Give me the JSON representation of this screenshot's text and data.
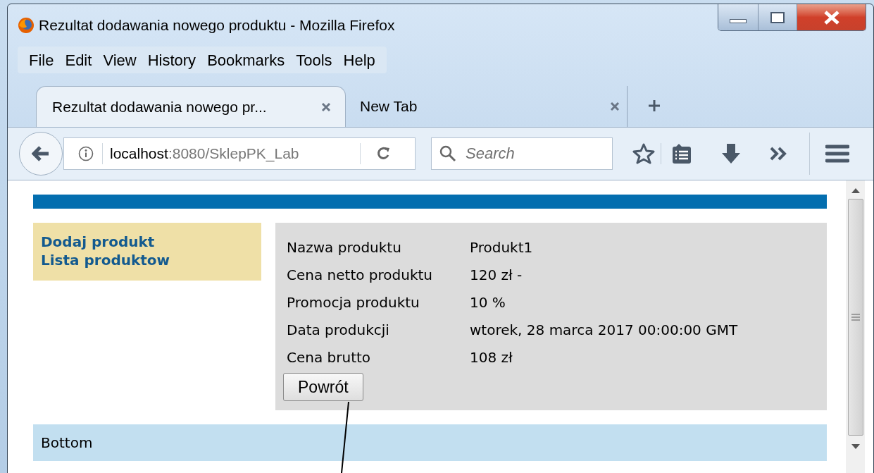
{
  "window": {
    "title": "Rezultat dodawania nowego produktu - Mozilla Firefox"
  },
  "menu": [
    "File",
    "Edit",
    "View",
    "History",
    "Bookmarks",
    "Tools",
    "Help"
  ],
  "tabs": [
    {
      "label": "Rezultat dodawania nowego pr...",
      "selected": true
    },
    {
      "label": "New Tab",
      "selected": false
    }
  ],
  "address_bar": {
    "host": "localhost",
    "path": ":8080/SklepPK_Lab"
  },
  "search": {
    "placeholder": "Search"
  },
  "page": {
    "nav_links": [
      "Dodaj produkt",
      "Lista produktow"
    ],
    "details": [
      {
        "label": "Nazwa produktu",
        "value": "Produkt1"
      },
      {
        "label": "Cena netto produktu",
        "value": "120 zł -"
      },
      {
        "label": "Promocja produktu",
        "value": "10 %"
      },
      {
        "label": "Data produkcji",
        "value": "wtorek, 28 marca 2017 00:00:00 GMT"
      },
      {
        "label": "Cena brutto",
        "value": "108 zł"
      }
    ],
    "button": "Powrót",
    "footer": "Bottom"
  }
}
